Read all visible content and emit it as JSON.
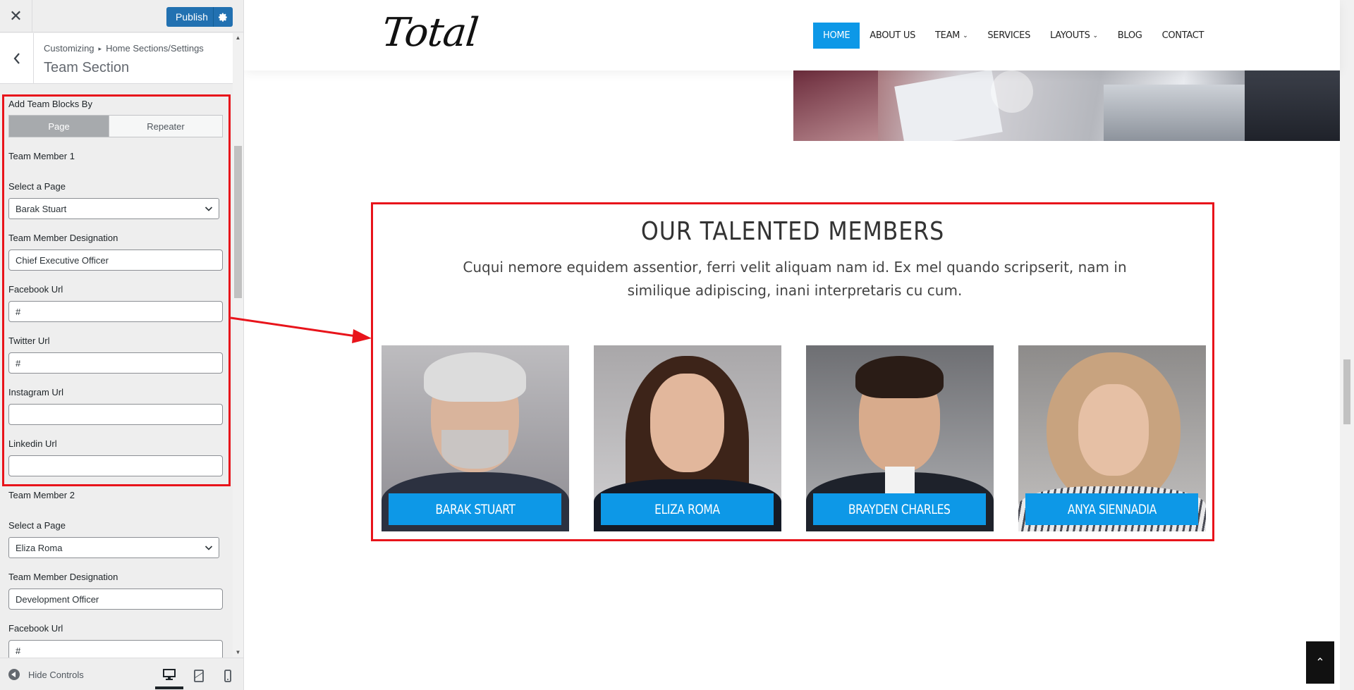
{
  "sidebar": {
    "close_icon": "close-icon",
    "publish_label": "Publish",
    "breadcrumb": {
      "root": "Customizing",
      "parent": "Home Sections/Settings"
    },
    "section_title": "Team Section",
    "add_team_blocks_label": "Add Team Blocks By",
    "segments": {
      "page": "Page",
      "repeater": "Repeater"
    },
    "member1": {
      "heading": "Team Member 1",
      "select_label": "Select a Page",
      "selected_page": "Barak Stuart",
      "designation_label": "Team Member Designation",
      "designation_value": "Chief Executive Officer",
      "facebook_label": "Facebook Url",
      "facebook_value": "#",
      "twitter_label": "Twitter Url",
      "twitter_value": "#",
      "instagram_label": "Instagram Url",
      "instagram_value": "",
      "linkedin_label": "Linkedin Url",
      "linkedin_value": ""
    },
    "member2": {
      "heading": "Team Member 2",
      "select_label": "Select a Page",
      "selected_page": "Eliza Roma",
      "designation_label": "Team Member Designation",
      "designation_value": "Development Officer",
      "facebook_label": "Facebook Url",
      "facebook_value": "#"
    },
    "footer": {
      "hide_controls": "Hide Controls"
    }
  },
  "site": {
    "logo": "Total",
    "nav": [
      {
        "label": "HOME"
      },
      {
        "label": "ABOUT US"
      },
      {
        "label": "TEAM"
      },
      {
        "label": "SERVICES"
      },
      {
        "label": "LAYOUTS"
      },
      {
        "label": "BLOG"
      },
      {
        "label": "CONTACT"
      }
    ],
    "team": {
      "title": "OUR TALENTED MEMBERS",
      "description": "Cuqui nemore equidem assentior, ferri velit aliquam nam id. Ex mel quando scripserit, nam in similique adipiscing, inani interpretaris cu cum.",
      "members": [
        {
          "name": "BARAK STUART"
        },
        {
          "name": "ELIZA ROMA"
        },
        {
          "name": "BRAYDEN CHARLES"
        },
        {
          "name": "ANYA SIENNADIA"
        }
      ]
    }
  },
  "colors": {
    "accent": "#0d98e7",
    "highlight": "#e8141b",
    "publish": "#2271b1"
  }
}
